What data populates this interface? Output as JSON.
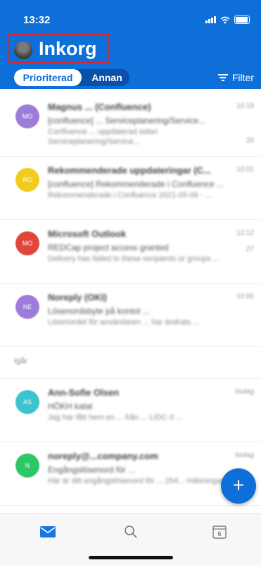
{
  "status_bar": {
    "time": "13:32"
  },
  "header": {
    "title": "Inkorg",
    "tabs": [
      {
        "label": "Prioriterad",
        "active": true
      },
      {
        "label": "Annan",
        "active": false
      }
    ],
    "filter_label": "Filter",
    "accent_color": "#0f6fd9"
  },
  "emails": [
    {
      "avatar_initials": "MO",
      "avatar_color": "#9d7bd8",
      "sender": "Magnus ...  (Confluence)",
      "time": "10:18",
      "subject": "[confluence] ... Serviceplanering/Service...",
      "preview": "Confluence ... uppdaterad sidan Serviceplanering/Service...",
      "count": "20"
    },
    {
      "avatar_initials": "RO",
      "avatar_color": "#f2cc1d",
      "sender": "Rekommenderade uppdateringar (C...",
      "time": "10:01",
      "subject": "[confluence] Rekommenderade i Confluence ...",
      "preview": "Rekommenderade i Confluence 2021-05-06 - ...",
      "count": ""
    },
    {
      "avatar_initials": "MO",
      "avatar_color": "#e0463a",
      "sender": "Microsoft Outlook",
      "time": "12:12",
      "subject": "REDCap project access granted",
      "preview": "Delivery has failed to these recipients or groups ...",
      "count": "27"
    },
    {
      "avatar_initials": "NE",
      "avatar_color": "#9d7bd8",
      "sender": "Noreply (OKI)",
      "time": "10:00",
      "subject": "Lösenordsbyte på kontot ...",
      "preview": "Lösenordet för användaren ... har ändrats ...",
      "count": ""
    }
  ],
  "section_label": "Igår",
  "emails_yesterday": [
    {
      "avatar_initials": "AS",
      "avatar_color": "#3cc3d0",
      "sender": "Ann-Sofie Olsen",
      "time": "tisdag",
      "subject": "HÖKH kalat",
      "preview": "Jag har fått hem en ... från ... LIDC-3 ...",
      "count": ""
    },
    {
      "avatar_initials": "N",
      "avatar_color": "#2ec766",
      "sender": "noreply@...company.com",
      "time": "tisdag",
      "subject": "Engångslösenord för ...",
      "preview": "Här är ditt engångslösenord för ... 254... Hälsningar ...",
      "count": ""
    }
  ],
  "fab_label": "+",
  "tabbar": {
    "calendar_day": "6"
  }
}
